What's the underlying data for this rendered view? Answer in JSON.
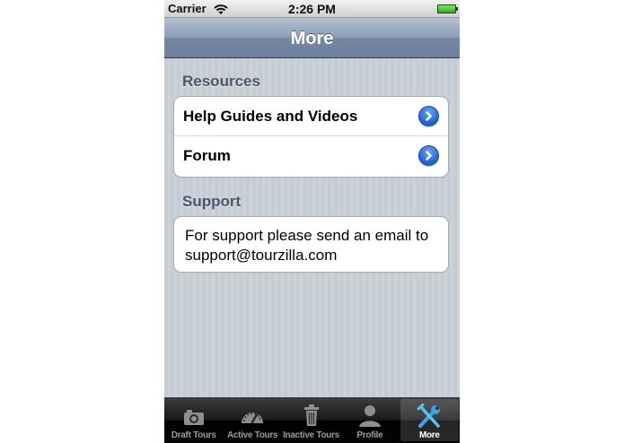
{
  "status_bar": {
    "carrier": "Carrier",
    "time": "2:26 PM",
    "wifi_icon": "wifi-icon",
    "battery_icon": "battery-icon"
  },
  "nav_bar": {
    "title": "More"
  },
  "resources": {
    "header": "Resources",
    "items": [
      {
        "label": "Help Guides and Videos",
        "icon": "disclosure-chevron-icon"
      },
      {
        "label": "Forum",
        "icon": "disclosure-chevron-icon"
      }
    ]
  },
  "support": {
    "header": "Support",
    "text": "For support please send an email to support@tourzilla.com"
  },
  "tab_bar": {
    "selected": "More",
    "tabs": [
      {
        "label": "Draft Tours",
        "icon": "camera-icon"
      },
      {
        "label": "Active Tours",
        "icon": "speedometer-icon"
      },
      {
        "label": "Inactive Tours",
        "icon": "trash-icon"
      },
      {
        "label": "Profile",
        "icon": "person-icon"
      },
      {
        "label": "More",
        "icon": "tools-icon"
      }
    ]
  },
  "colors": {
    "nav_bar": "#6d82a0",
    "section_header": "#4c566c",
    "disclosure": "#1f5fcf",
    "tab_selected_icon": "#3aa6e6"
  }
}
